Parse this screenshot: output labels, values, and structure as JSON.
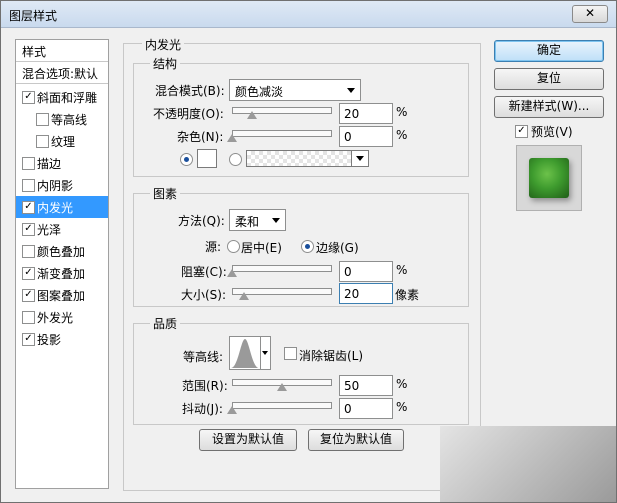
{
  "window": {
    "title": "图层样式",
    "close_label": "✕"
  },
  "sidebar": {
    "header": "样式",
    "blend_default": "混合选项:默认",
    "items": [
      {
        "label": "斜面和浮雕",
        "checked": true
      },
      {
        "label": "等高线",
        "checked": false
      },
      {
        "label": "纹理",
        "checked": false
      },
      {
        "label": "描边",
        "checked": false
      },
      {
        "label": "内阴影",
        "checked": false
      },
      {
        "label": "内发光",
        "checked": true,
        "selected": true
      },
      {
        "label": "光泽",
        "checked": true
      },
      {
        "label": "颜色叠加",
        "checked": false
      },
      {
        "label": "渐变叠加",
        "checked": true
      },
      {
        "label": "图案叠加",
        "checked": true
      },
      {
        "label": "外发光",
        "checked": false
      },
      {
        "label": "投影",
        "checked": true
      }
    ]
  },
  "panel": {
    "title": "内发光",
    "structure": {
      "title": "结构",
      "blend_mode_label": "混合模式(B):",
      "blend_mode_value": "颜色减淡",
      "opacity_label": "不透明度(O):",
      "opacity_value": "20",
      "opacity_unit": "%",
      "opacity_level": 0.2,
      "noise_label": "杂色(N):",
      "noise_value": "0",
      "noise_unit": "%",
      "noise_level": 0.0
    },
    "elements": {
      "title": "图素",
      "technique_label": "方法(Q):",
      "technique_value": "柔和",
      "source_label": "源:",
      "center_label": "居中(E)",
      "edge_label": "边缘(G)",
      "choke_label": "阻塞(C):",
      "choke_value": "0",
      "choke_unit": "%",
      "choke_level": 0.0,
      "size_label": "大小(S):",
      "size_value": "20",
      "size_unit": "像素",
      "size_level": 0.08
    },
    "quality": {
      "title": "品质",
      "contour_label": "等高线:",
      "antialias_label": "消除锯齿(L)",
      "range_label": "范围(R):",
      "range_value": "50",
      "range_unit": "%",
      "range_level": 0.5,
      "jitter_label": "抖动(J):",
      "jitter_value": "0",
      "jitter_unit": "%",
      "jitter_level": 0.0
    },
    "make_default": "设置为默认值",
    "reset_default": "复位为默认值"
  },
  "actions": {
    "ok": "确定",
    "reset": "复位",
    "new_style": "新建样式(W)...",
    "preview_label": "预览(V)",
    "preview_checked": true
  },
  "colors": {
    "selection": "#3399ff",
    "preview_green": "#3e9b2e"
  }
}
